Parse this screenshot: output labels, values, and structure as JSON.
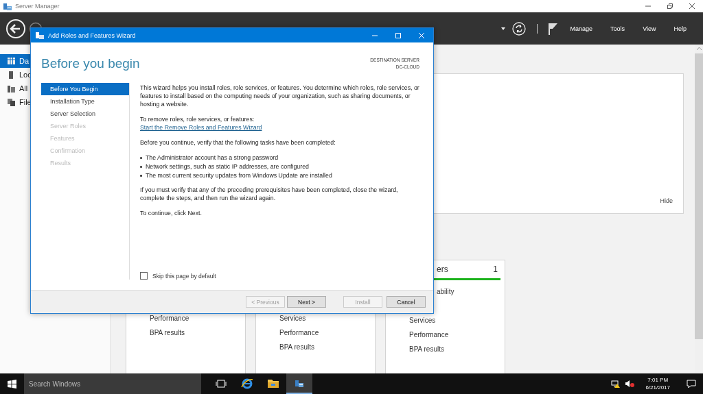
{
  "window": {
    "title": "Server Manager"
  },
  "header": {
    "menu": [
      "Manage",
      "Tools",
      "View",
      "Help"
    ]
  },
  "sidebar": {
    "items": [
      {
        "label": "Da",
        "selected": true
      },
      {
        "label": "Loc",
        "selected": false
      },
      {
        "label": "All",
        "selected": false
      },
      {
        "label": "File",
        "selected": false
      }
    ]
  },
  "welcome_panel": {
    "hide_link": "Hide"
  },
  "tiles": [
    {
      "items": [
        "Performance",
        "BPA results"
      ]
    },
    {
      "items": [
        "Services",
        "Performance",
        "BPA results"
      ]
    },
    {
      "heading": "ers",
      "count": "1",
      "color": "#1db31d",
      "items": [
        "ability",
        "Services",
        "Performance",
        "BPA results"
      ]
    }
  ],
  "wizard": {
    "title": "Add Roles and Features Wizard",
    "heading": "Before you begin",
    "destination_label": "DESTINATION SERVER",
    "destination_server": "DC-CLOUD",
    "steps": [
      {
        "label": "Before You Begin",
        "selected": true,
        "disabled": false
      },
      {
        "label": "Installation Type",
        "selected": false,
        "disabled": false
      },
      {
        "label": "Server Selection",
        "selected": false,
        "disabled": false
      },
      {
        "label": "Server Roles",
        "selected": false,
        "disabled": true
      },
      {
        "label": "Features",
        "selected": false,
        "disabled": true
      },
      {
        "label": "Confirmation",
        "selected": false,
        "disabled": true
      },
      {
        "label": "Results",
        "selected": false,
        "disabled": true
      }
    ],
    "content": [
      {
        "kind": "paragraph",
        "text": "This wizard helps you install roles, role services, or features. You determine which roles, role services, or features to install based on the computing needs of your organization, such as sharing documents, or hosting a website."
      },
      {
        "kind": "paragraph",
        "text": "To remove roles, role services, or features:"
      },
      {
        "kind": "link",
        "text": "Start the Remove Roles and Features Wizard"
      },
      {
        "kind": "paragraph",
        "text": "Before you continue, verify that the following tasks have been completed:"
      },
      {
        "kind": "bullets",
        "items": [
          "The Administrator account has a strong password",
          "Network settings, such as static IP addresses, are configured",
          "The most current security updates from Windows Update are installed"
        ]
      },
      {
        "kind": "paragraph",
        "text": "If you must verify that any of the preceding prerequisites have been completed, close the wizard, complete the steps, and then run the wizard again."
      },
      {
        "kind": "paragraph",
        "text": "To continue, click Next."
      }
    ],
    "skip_checkbox": {
      "label": "Skip this page by default",
      "checked": false
    },
    "buttons": [
      {
        "label": "< Previous",
        "disabled": true
      },
      {
        "label": "Next >",
        "disabled": false
      },
      {
        "label": "Install",
        "disabled": true
      },
      {
        "label": "Cancel",
        "disabled": false
      }
    ]
  },
  "taskbar": {
    "search_placeholder": "Search Windows",
    "time": "7:01 PM",
    "date": "6/21/2017"
  }
}
